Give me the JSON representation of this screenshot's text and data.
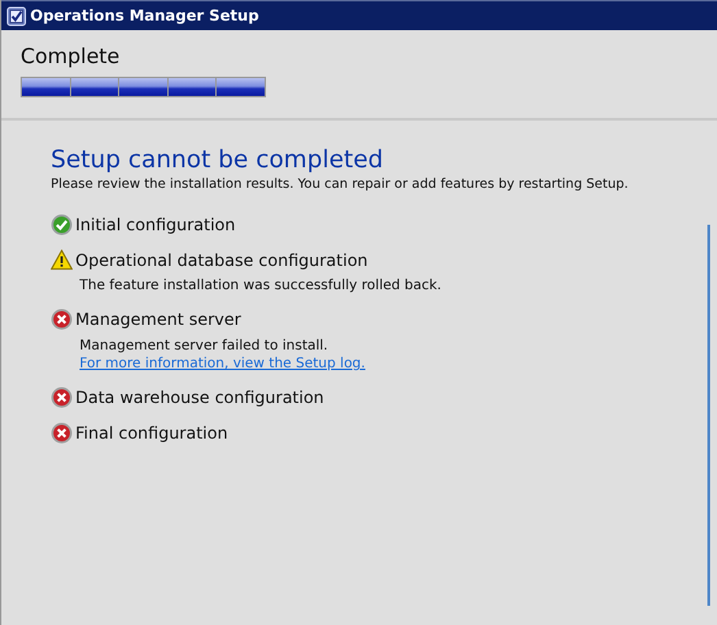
{
  "window": {
    "title": "Operations Manager Setup"
  },
  "header": {
    "title": "Complete",
    "progress": {
      "level": 1
    }
  },
  "result": {
    "heading": "Setup cannot be completed",
    "subtitle": "Please review the installation results.  You can repair or add features by restarting Setup."
  },
  "features": [
    {
      "name": "Initial configuration",
      "kind": "success"
    },
    {
      "name": "Operational database configuration",
      "kind": "warning",
      "messages": [
        {
          "kind": "text",
          "text": "The feature installation was successfully rolled back."
        }
      ]
    },
    {
      "name": "Management server",
      "kind": "error",
      "messages": [
        {
          "kind": "text",
          "text": "Management server failed to install."
        },
        {
          "kind": "link",
          "text": "For more information, view the Setup log."
        }
      ]
    },
    {
      "name": "Data warehouse configuration",
      "kind": "error"
    },
    {
      "name": "Final configuration",
      "kind": "error"
    }
  ]
}
